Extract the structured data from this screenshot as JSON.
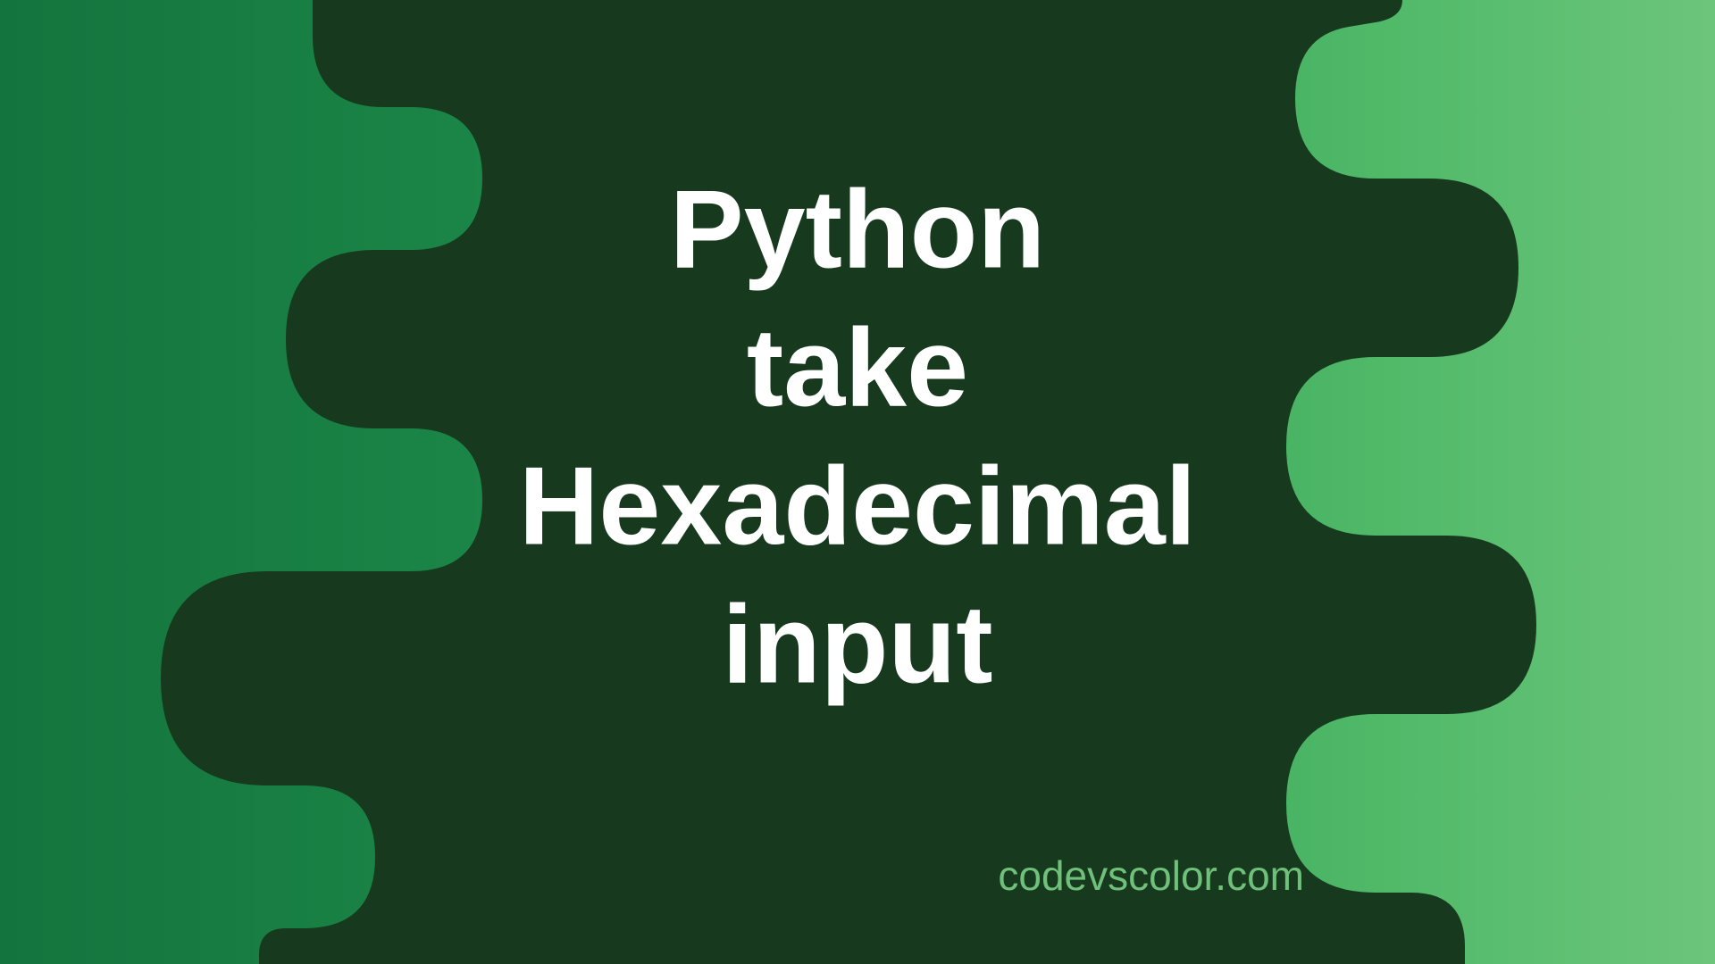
{
  "title": {
    "line1": "Python",
    "line2": "take",
    "line3": "Hexadecimal",
    "line4": "input"
  },
  "footer": "codevscolor.com",
  "colors": {
    "blob": "#173a1e",
    "text": "#ffffff",
    "footer": "#6fc07a"
  }
}
